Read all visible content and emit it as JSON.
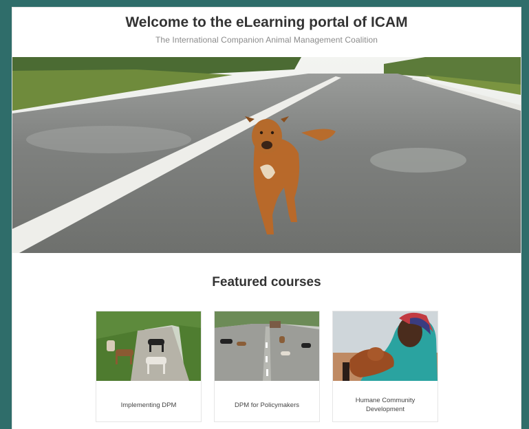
{
  "header": {
    "title": "Welcome to the eLearning portal of ICAM",
    "subtitle": "The International Companion Animal Management Coalition"
  },
  "hero": {
    "image": "dog-walking-on-road-photo"
  },
  "featured": {
    "heading": "Featured courses",
    "courses": [
      {
        "label": "Implementing DPM",
        "image": "dogs-on-rural-road-photo"
      },
      {
        "label": "DPM for Policymakers",
        "image": "dogs-on-town-street-photo"
      },
      {
        "label": "Humane Community Development",
        "image": "woman-holding-puppy-photo"
      }
    ]
  },
  "colors": {
    "background": "#2f6d6a",
    "card": "#ffffff",
    "heading": "#333333",
    "subtitle": "#8a8a8a"
  }
}
